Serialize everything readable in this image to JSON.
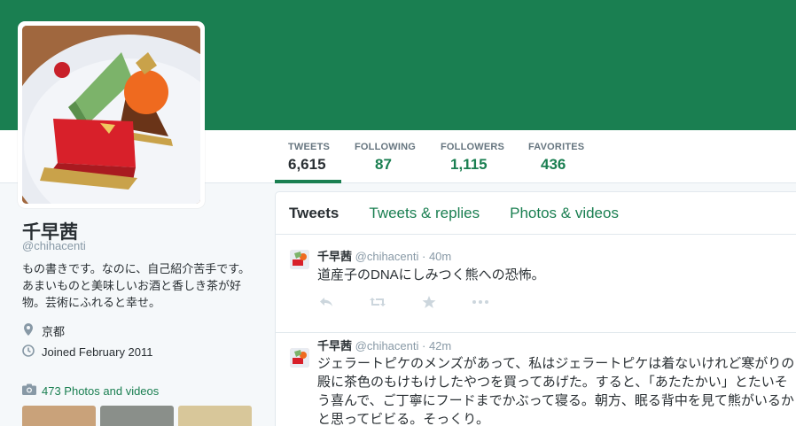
{
  "profile": {
    "name": "千早茜",
    "handle": "@chihacenti",
    "bio": "もの書きです。なのに、自己紹介苦手です。 あまいものと美味しいお酒と香しき茶が好物。芸術にふれると幸せ。",
    "location": "京都",
    "joined": "Joined February 2011",
    "photos_link": "473 Photos and videos"
  },
  "stats": [
    {
      "label": "TWEETS",
      "value": "6,615"
    },
    {
      "label": "FOLLOWING",
      "value": "87"
    },
    {
      "label": "FOLLOWERS",
      "value": "1,115"
    },
    {
      "label": "FAVORITES",
      "value": "436"
    }
  ],
  "tabs": [
    "Tweets",
    "Tweets & replies",
    "Photos & videos"
  ],
  "tweets": [
    {
      "name": "千早茜",
      "handle": "@chihacenti",
      "time": "· 40m",
      "text": "道産子のDNAにしみつく熊への恐怖。"
    },
    {
      "name": "千早茜",
      "handle": "@chihacenti",
      "time": "· 42m",
      "text": "ジェラートピケのメンズがあって、私はジェラートピケは着ないけれど寒がりの殿に茶色のもけもけしたやつを買ってあげた。すると、「あたたかい」とたいそう喜んで、ご丁寧にフードまでかぶって寝る。朝方、眠る背中を見て熊がいるかと思ってビビる。そっくり。"
    }
  ],
  "icons": {
    "location": "map-pin-icon",
    "joined": "clock-icon",
    "photos": "camera-icon",
    "reply": "reply-icon",
    "retweet": "retweet-icon",
    "favorite": "star-icon",
    "more": "more-icon"
  },
  "colors": {
    "brand": "#1a7f51",
    "text": "#292f33",
    "muted": "#8899a6",
    "icon": "#ccd6dd"
  }
}
